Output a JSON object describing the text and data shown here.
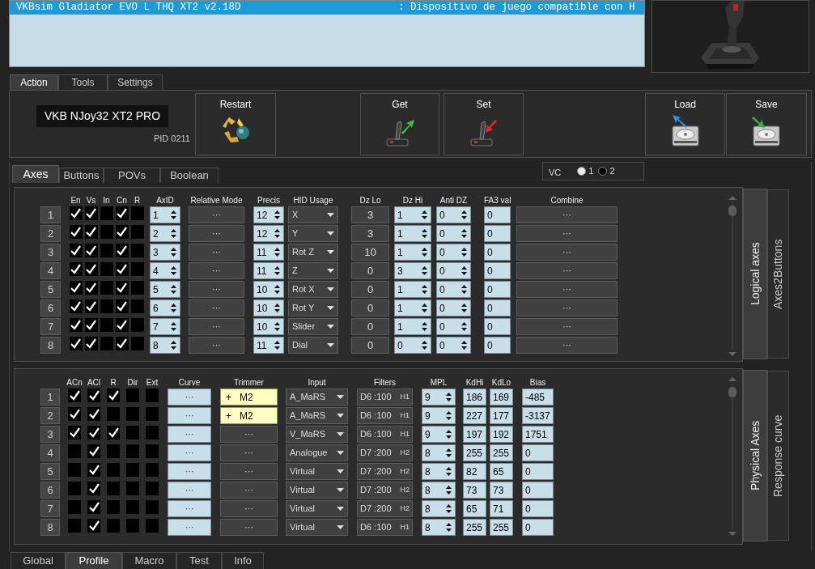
{
  "device_list": {
    "rows": [
      {
        "name": "VKBsim Gladiator EVO L THQ XT2 v2.18D",
        "description": ": Dispositivo de juego  compatible con H",
        "selected": true
      }
    ]
  },
  "top_tabs": [
    {
      "label": "Action",
      "selected": true
    },
    {
      "label": "Tools",
      "selected": false
    },
    {
      "label": "Settings",
      "selected": false
    }
  ],
  "action_panel": {
    "device_name": "VKB NJoy32 XT2 PRO",
    "pid": "PID 0211",
    "buttons": [
      {
        "label": "Restart",
        "kind": "restart"
      },
      {
        "label": "Get",
        "kind": "get"
      },
      {
        "label": "Set",
        "kind": "set"
      },
      {
        "label": "Load",
        "kind": "load"
      },
      {
        "label": "Save",
        "kind": "save"
      }
    ]
  },
  "section_tabs": [
    {
      "label": "Axes",
      "selected": true
    },
    {
      "label": "Buttons",
      "selected": false
    },
    {
      "label": "POVs",
      "selected": false
    },
    {
      "label": "Boolean",
      "selected": false
    }
  ],
  "vc": {
    "label": "VC",
    "options": [
      {
        "label": "1",
        "selected": true
      },
      {
        "label": "2",
        "selected": false
      }
    ]
  },
  "logical_axes": {
    "columns": [
      "En",
      "Vs",
      "In",
      "Cn",
      "R",
      "AxID",
      "Relative Mode",
      "Precis",
      "HID Usage",
      "Dz Lo",
      "Dz Hi",
      "Anti DZ",
      "FA3 val",
      "Combine"
    ],
    "rows": [
      {
        "number": "1",
        "en": true,
        "vs": true,
        "in": false,
        "cn": true,
        "r": false,
        "axid": "1",
        "relative_mode": "···",
        "precis": "12",
        "hid_usage": "X",
        "dz_lo": "3",
        "dz_hi": "1",
        "anti_dz": "0",
        "fa3_val": "0",
        "combine": "···"
      },
      {
        "number": "2",
        "en": true,
        "vs": true,
        "in": false,
        "cn": true,
        "r": false,
        "axid": "2",
        "relative_mode": "···",
        "precis": "12",
        "hid_usage": "Y",
        "dz_lo": "3",
        "dz_hi": "1",
        "anti_dz": "0",
        "fa3_val": "0",
        "combine": "···"
      },
      {
        "number": "3",
        "en": true,
        "vs": true,
        "in": false,
        "cn": true,
        "r": false,
        "axid": "3",
        "relative_mode": "···",
        "precis": "11",
        "hid_usage": "Rot Z",
        "dz_lo": "10",
        "dz_hi": "1",
        "anti_dz": "0",
        "fa3_val": "0",
        "combine": "···"
      },
      {
        "number": "4",
        "en": true,
        "vs": true,
        "in": false,
        "cn": true,
        "r": false,
        "axid": "4",
        "relative_mode": "···",
        "precis": "11",
        "hid_usage": "Z",
        "dz_lo": "0",
        "dz_hi": "3",
        "anti_dz": "0",
        "fa3_val": "0",
        "combine": "···"
      },
      {
        "number": "5",
        "en": true,
        "vs": true,
        "in": false,
        "cn": true,
        "r": false,
        "axid": "5",
        "relative_mode": "···",
        "precis": "10",
        "hid_usage": "Rot X",
        "dz_lo": "0",
        "dz_hi": "1",
        "anti_dz": "0",
        "fa3_val": "0",
        "combine": "···"
      },
      {
        "number": "6",
        "en": true,
        "vs": true,
        "in": false,
        "cn": true,
        "r": false,
        "axid": "6",
        "relative_mode": "···",
        "precis": "10",
        "hid_usage": "Rot Y",
        "dz_lo": "0",
        "dz_hi": "1",
        "anti_dz": "0",
        "fa3_val": "0",
        "combine": "···"
      },
      {
        "number": "7",
        "en": true,
        "vs": true,
        "in": false,
        "cn": true,
        "r": false,
        "axid": "7",
        "relative_mode": "···",
        "precis": "10",
        "hid_usage": "Slider",
        "dz_lo": "0",
        "dz_hi": "1",
        "anti_dz": "0",
        "fa3_val": "0",
        "combine": "···"
      },
      {
        "number": "8",
        "en": true,
        "vs": true,
        "in": false,
        "cn": true,
        "r": false,
        "axid": "8",
        "relative_mode": "···",
        "precis": "11",
        "hid_usage": "Dial",
        "dz_lo": "0",
        "dz_hi": "0",
        "anti_dz": "0",
        "fa3_val": "0",
        "combine": "···"
      }
    ]
  },
  "logical_side_tabs": [
    {
      "label": "Logical axes",
      "selected": true
    },
    {
      "label": "Axes2Buttons",
      "selected": false
    }
  ],
  "physical_axes": {
    "columns": [
      "ACn",
      "ACl",
      "R",
      "Dir",
      "Ext",
      "Curve",
      "Trimmer",
      "Input",
      "Filters",
      "MPL",
      "KdHi",
      "KdLo",
      "Bias"
    ],
    "rows": [
      {
        "number": "1",
        "acn": true,
        "acl": true,
        "r": true,
        "dir": false,
        "ext": false,
        "curve": "···",
        "trimmer": {
          "kind": "assigned",
          "sign": "+",
          "value": "M2"
        },
        "input": "A_MaRS",
        "filter": "D6 :100",
        "filter_mode": "H1",
        "mpl": "9",
        "kd_hi": "186",
        "kd_lo": "169",
        "bias": "-485"
      },
      {
        "number": "2",
        "acn": true,
        "acl": true,
        "r": false,
        "dir": false,
        "ext": false,
        "curve": "···",
        "trimmer": {
          "kind": "assigned",
          "sign": "+",
          "value": "M2"
        },
        "input": "A_MaRS",
        "filter": "D6 :100",
        "filter_mode": "H1",
        "mpl": "9",
        "kd_hi": "227",
        "kd_lo": "177",
        "bias": "-3137"
      },
      {
        "number": "3",
        "acn": true,
        "acl": true,
        "r": true,
        "dir": false,
        "ext": false,
        "curve": "···",
        "trimmer": {
          "kind": "empty",
          "text": "···"
        },
        "input": "V_MaRS",
        "filter": "D6 :100",
        "filter_mode": "H1",
        "mpl": "9",
        "kd_hi": "197",
        "kd_lo": "192",
        "bias": "1751"
      },
      {
        "number": "4",
        "acn": false,
        "acl": true,
        "r": false,
        "dir": false,
        "ext": false,
        "curve": "···",
        "trimmer": {
          "kind": "empty",
          "text": "···"
        },
        "input": "Analogue",
        "filter": "D7 :200",
        "filter_mode": "H2",
        "mpl": "8",
        "kd_hi": "255",
        "kd_lo": "255",
        "bias": "0"
      },
      {
        "number": "5",
        "acn": false,
        "acl": true,
        "r": false,
        "dir": false,
        "ext": false,
        "curve": "···",
        "trimmer": {
          "kind": "empty",
          "text": "···"
        },
        "input": "Virtual",
        "filter": "D7 :200",
        "filter_mode": "H2",
        "mpl": "8",
        "kd_hi": "82",
        "kd_lo": "65",
        "bias": "0"
      },
      {
        "number": "6",
        "acn": false,
        "acl": true,
        "r": false,
        "dir": false,
        "ext": false,
        "curve": "···",
        "trimmer": {
          "kind": "empty",
          "text": "···"
        },
        "input": "Virtual",
        "filter": "D7 :200",
        "filter_mode": "H2",
        "mpl": "8",
        "kd_hi": "73",
        "kd_lo": "73",
        "bias": "0"
      },
      {
        "number": "7",
        "acn": false,
        "acl": true,
        "r": false,
        "dir": false,
        "ext": false,
        "curve": "···",
        "trimmer": {
          "kind": "empty",
          "text": "···"
        },
        "input": "Virtual",
        "filter": "D7 :200",
        "filter_mode": "H2",
        "mpl": "8",
        "kd_hi": "65",
        "kd_lo": "71",
        "bias": "0"
      },
      {
        "number": "8",
        "acn": false,
        "acl": true,
        "r": false,
        "dir": false,
        "ext": false,
        "curve": "···",
        "trimmer": {
          "kind": "empty",
          "text": "···"
        },
        "input": "Virtual",
        "filter": "D6 :100",
        "filter_mode": "H1",
        "mpl": "8",
        "kd_hi": "255",
        "kd_lo": "255",
        "bias": "0"
      }
    ]
  },
  "physical_side_tabs": [
    {
      "label": "Physical Axes",
      "selected": true
    },
    {
      "label": "Response curve",
      "selected": false
    }
  ],
  "bottom_tabs": [
    {
      "label": "Global",
      "selected": false
    },
    {
      "label": "Profile",
      "selected": true
    },
    {
      "label": "Macro",
      "selected": false
    },
    {
      "label": "Test",
      "selected": false
    },
    {
      "label": "Info",
      "selected": false
    }
  ]
}
